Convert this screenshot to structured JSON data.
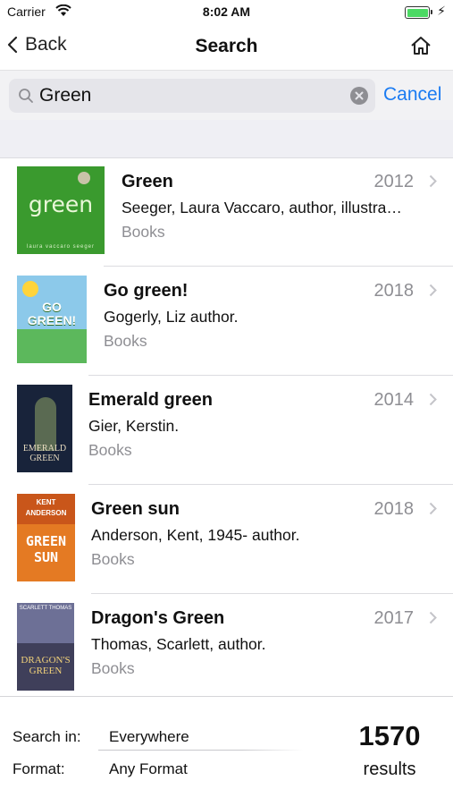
{
  "status_bar": {
    "carrier": "Carrier",
    "time": "8:02 AM"
  },
  "nav": {
    "back_label": "Back",
    "title": "Search"
  },
  "search": {
    "query": "Green",
    "cancel_label": "Cancel"
  },
  "results": [
    {
      "title": "Green",
      "year": "2012",
      "author": "Seeger, Laura Vaccaro, author, illustra…",
      "format": "Books",
      "cover": {
        "text": "green",
        "subtext": "laura vaccaro seeger"
      }
    },
    {
      "title": "Go green!",
      "year": "2018",
      "author": "Gogerly, Liz author.",
      "format": "Books",
      "cover": {
        "text": "GO GREEN!"
      }
    },
    {
      "title": "Emerald green",
      "year": "2014",
      "author": "Gier, Kerstin.",
      "format": "Books",
      "cover": {
        "text": "EMERALD GREEN"
      }
    },
    {
      "title": "Green sun",
      "year": "2018",
      "author": "Anderson, Kent, 1945- author.",
      "format": "Books",
      "cover": {
        "top": "KENT ANDERSON",
        "text": "GREEN SUN"
      }
    },
    {
      "title": "Dragon's Green",
      "year": "2017",
      "author": "Thomas, Scarlett, author.",
      "format": "Books",
      "cover": {
        "top": "SCARLETT THOMAS",
        "text": "DRAGON'S GREEN"
      }
    }
  ],
  "footer": {
    "search_in_label": "Search in:",
    "search_in_value": "Everywhere",
    "format_label": "Format:",
    "format_value": "Any Format",
    "count": "1570",
    "count_label": "results"
  },
  "colors": {
    "accent": "#1a7bf2",
    "secondary_text": "#8e8e93",
    "battery": "#4cd964"
  }
}
